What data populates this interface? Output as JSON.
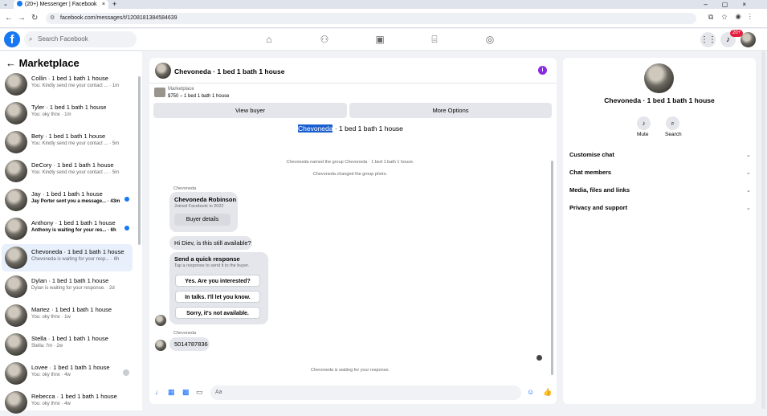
{
  "browser": {
    "tab_title": "(20+) Messenger | Facebook",
    "url": "facebook.com/messages/t/1208181384584639"
  },
  "fb": {
    "search_placeholder": "Search Facebook",
    "notif_count": "20+"
  },
  "sidebar": {
    "title": "Marketplace",
    "conversations": [
      {
        "title": "Collin · 1 bed 1 bath 1 house",
        "snippet": "You: Kindly send me your contact ... · 1m",
        "unread": false
      },
      {
        "title": "Tyler · 1 bed 1 bath 1 house",
        "snippet": "You: oky thnx · 1m",
        "unread": false
      },
      {
        "title": "Bety · 1 bed 1 bath 1 house",
        "snippet": "You: Kindly send me your contact ... · 5m",
        "unread": false
      },
      {
        "title": "DeCory · 1 bed 1 bath 1 house",
        "snippet": "You: Kindly send me your contact ... · 5m",
        "unread": false
      },
      {
        "title": "Jay · 1 bed 1 bath 1 house",
        "snippet": "Jay Porter sent you a message... · 43m",
        "unread": true
      },
      {
        "title": "Anthony · 1 bed 1 bath 1 house",
        "snippet": "Anthony is waiting for your res... · 6h",
        "unread": true
      },
      {
        "title": "Chevoneda · 1 bed 1 bath 1 house",
        "snippet": "Chevoneda is waiting for your resp... · 6h",
        "unread": false,
        "active": true
      },
      {
        "title": "Dylan · 1 bed 1 bath 1 house",
        "snippet": "Dylan is waiting for your response. · 2d",
        "unread": false
      },
      {
        "title": "Martez · 1 bed 1 bath 1 house",
        "snippet": "You: oky thnx · 1w",
        "unread": false
      },
      {
        "title": "Stella · 1 bed 1 bath 1 house",
        "snippet": "Stella: I'm · 2w",
        "unread": false
      },
      {
        "title": "Lovee · 1 bed 1 bath 1 house",
        "snippet": "You: oky thnx · 4w",
        "unread": false
      },
      {
        "title": "Rebecca · 1 bed 1 bath 1 house",
        "snippet": "You: oky thnx · 4w",
        "unread": false
      }
    ]
  },
  "chat": {
    "header_title": "Chevoneda · 1 bed 1 bath 1 house",
    "mp_label": "Marketplace",
    "mp_listing": "$750 – 1 bed 1 bath 1 house",
    "view_buyer": "View buyer",
    "more_options": "More Options",
    "group_title_hl": "Chevoneda",
    "group_title_rest": " · 1 bed 1 bath 1 house",
    "sys1": "Chevoneda named the group Chevoneda · 1 bed 1 bath 1 house.",
    "sys2": "Chevoneda changed the group photo.",
    "sender": "Chevoneda",
    "card_name": "Chevoneda Robinson",
    "card_sub": "Joined Facebook in 2022",
    "card_button": "Buyer details",
    "msg1": "Hi Diev, is this still available?",
    "quick_title": "Send a quick response",
    "quick_sub": "Tap a response to send it to the buyer.",
    "quick": [
      "Yes. Are you interested?",
      "In talks. I'll let you know.",
      "Sorry, it's not available."
    ],
    "sender2": "Chevoneda",
    "msg2": "5014787836",
    "waiting": "Chevoneda is waiting for your response.",
    "composer_placeholder": "Aa"
  },
  "details": {
    "name": "Chevoneda · 1 bed 1 bath 1 house",
    "mute": "Mute",
    "search": "Search",
    "sections": [
      "Customise chat",
      "Chat members",
      "Media, files and links",
      "Privacy and support"
    ]
  },
  "colors": {
    "accent": "#1877f2",
    "info": "#8a2be2"
  }
}
